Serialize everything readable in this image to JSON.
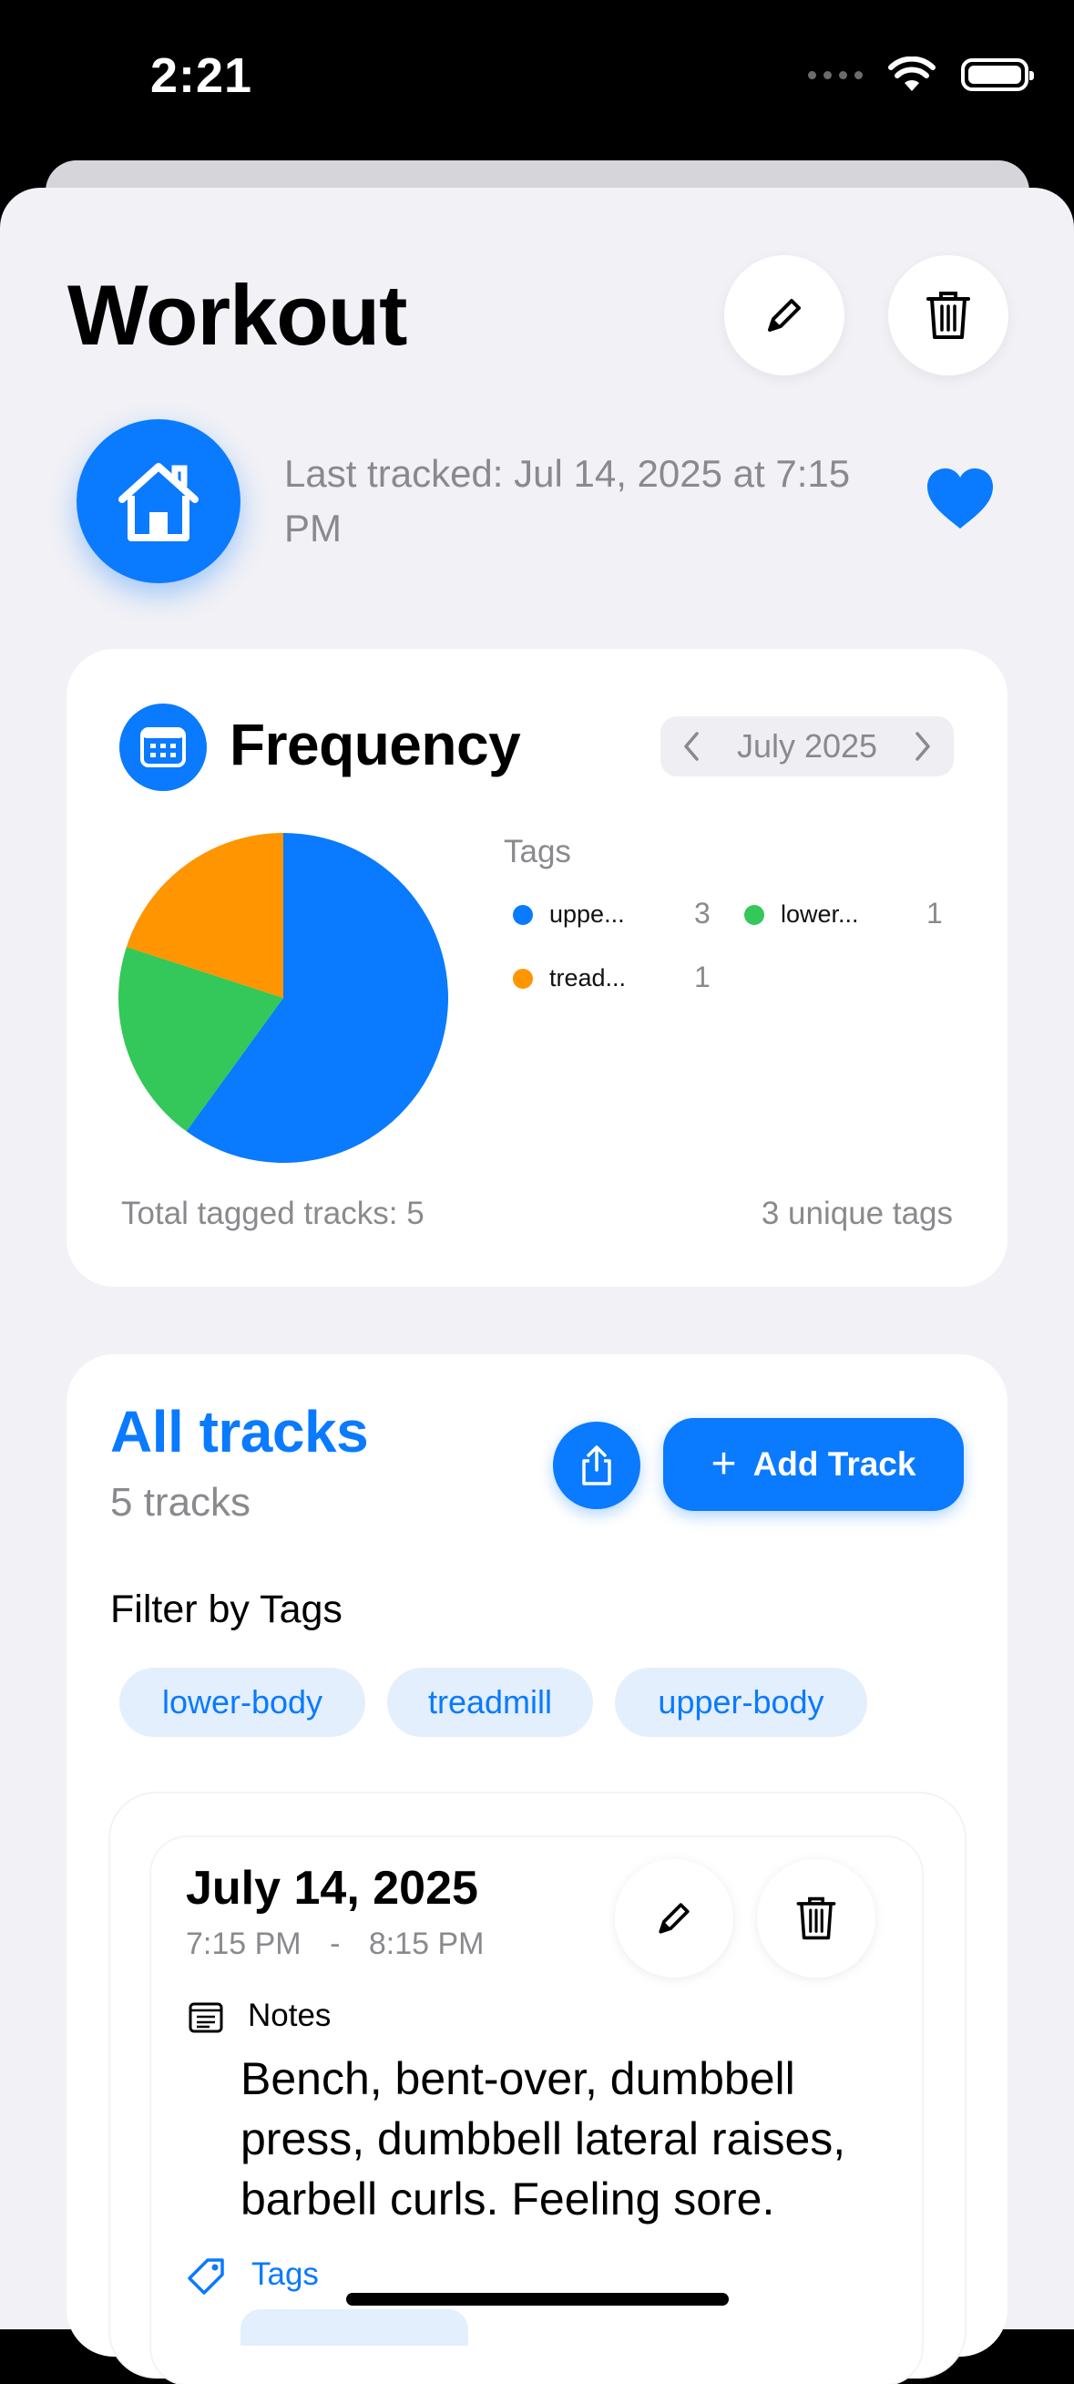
{
  "status_bar": {
    "time": "2:21"
  },
  "header": {
    "title": "Workout",
    "last_tracked": "Last tracked: Jul 14, 2025 at 7:15 PM"
  },
  "frequency": {
    "title": "Frequency",
    "month": "July 2025",
    "legend_title": "Tags",
    "total_label": "Total tagged tracks: 5",
    "unique_label": "3 unique tags"
  },
  "chart_data": {
    "type": "pie",
    "title": "",
    "categories": [
      "uppe...",
      "lower...",
      "tread..."
    ],
    "values": [
      3,
      1,
      1
    ],
    "colors": [
      "#0a7aff",
      "#34c759",
      "#ff9500"
    ],
    "legend_placement": "right"
  },
  "tracks": {
    "title": "All tracks",
    "count": "5 tracks",
    "add_label": "Add Track",
    "filter_label": "Filter by Tags",
    "filter_chips": [
      "lower-body",
      "treadmill",
      "upper-body"
    ]
  },
  "entry": {
    "date": "July 14, 2025",
    "start": "7:15 PM",
    "separator": "-",
    "end": "8:15 PM",
    "notes_label": "Notes",
    "notes_text": "Bench, bent-over, dumbbell press, dumbbell lateral raises, barbell curls. Feeling sore.",
    "tags_label": "Tags"
  },
  "colors": {
    "accent": "#0a7aff",
    "background": "#f1f1f6"
  }
}
